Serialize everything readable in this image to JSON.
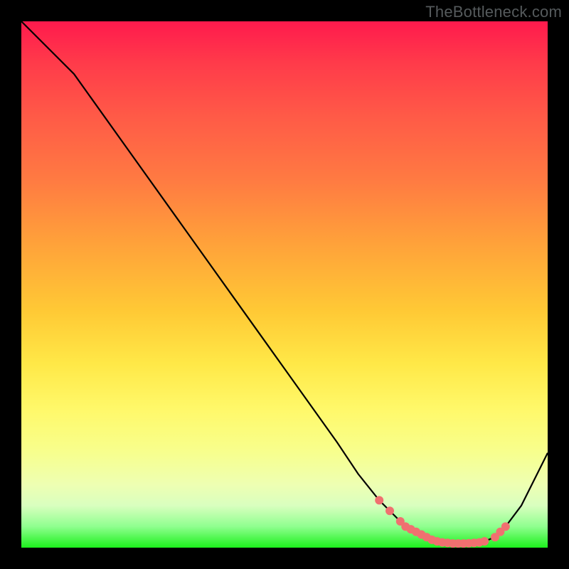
{
  "watermark": "TheBottleneck.com",
  "colors": {
    "background": "#000000",
    "curve": "#000000",
    "markers": "#f07070"
  },
  "chart_data": {
    "type": "line",
    "title": "",
    "xlabel": "",
    "ylabel": "",
    "xlim": [
      0,
      100
    ],
    "ylim": [
      0,
      100
    ],
    "grid": false,
    "legend": false,
    "series": [
      {
        "name": "bottleneck-curve",
        "x": [
          0,
          6,
          10,
          20,
          30,
          40,
          50,
          60,
          64,
          68,
          72,
          75,
          78,
          80,
          82,
          84,
          86,
          88,
          90,
          92,
          95,
          100
        ],
        "values": [
          100,
          94,
          90,
          76,
          62,
          48,
          34,
          20,
          14,
          9,
          5,
          3,
          1.5,
          1,
          0.8,
          0.8,
          0.9,
          1.2,
          2,
          4,
          8,
          18
        ]
      }
    ],
    "markers": {
      "name": "highlight-points",
      "x": [
        68,
        70,
        72,
        73,
        74,
        75,
        76,
        77,
        78,
        79,
        80,
        81,
        82,
        83,
        84,
        85,
        86,
        87,
        88,
        90,
        91,
        92
      ],
      "values": [
        9,
        7,
        5,
        4,
        3.5,
        3,
        2.5,
        2,
        1.5,
        1.2,
        1,
        0.9,
        0.8,
        0.8,
        0.8,
        0.85,
        0.9,
        1,
        1.2,
        2,
        3,
        4
      ]
    }
  }
}
